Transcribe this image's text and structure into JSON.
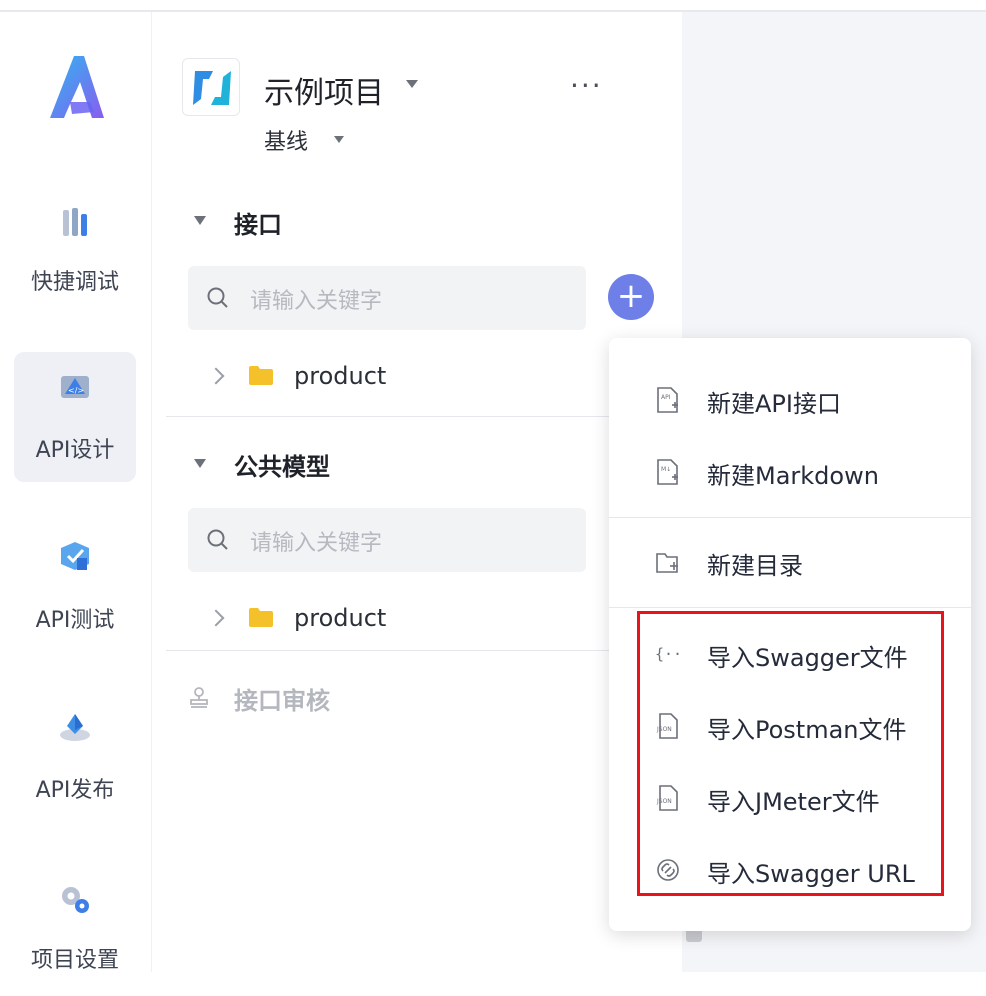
{
  "rail": {
    "items": [
      {
        "label": "快捷调试",
        "icon": "quick-debug-icon"
      },
      {
        "label": "API设计",
        "icon": "api-design-icon",
        "active": true
      },
      {
        "label": "API测试",
        "icon": "api-test-icon"
      },
      {
        "label": "API发布",
        "icon": "api-publish-icon"
      },
      {
        "label": "项目设置",
        "icon": "project-settings-icon"
      }
    ]
  },
  "project": {
    "name": "示例项目",
    "branch": "基线",
    "more": "···"
  },
  "sections": {
    "interfaces": {
      "title": "接口",
      "search_placeholder": "请输入关键字",
      "folder": "product"
    },
    "models": {
      "title": "公共模型",
      "search_placeholder": "请输入关键字",
      "folder": "product"
    },
    "audit": {
      "title": "接口审核"
    }
  },
  "add_button": "+",
  "menu": {
    "items": [
      {
        "label": "新建API接口",
        "icon": "new-api-file-icon"
      },
      {
        "label": "新建Markdown",
        "icon": "new-markdown-file-icon"
      },
      {
        "label": "新建目录",
        "icon": "new-folder-icon"
      },
      {
        "label": "导入Swagger文件",
        "icon": "braces-file-icon"
      },
      {
        "label": "导入Postman文件",
        "icon": "json-file-icon"
      },
      {
        "label": "导入JMeter文件",
        "icon": "json-file-icon"
      },
      {
        "label": "导入Swagger URL",
        "icon": "link-icon"
      }
    ]
  },
  "colors": {
    "accent": "#6e7fe8",
    "highlight": "#e8141a",
    "folder": "#f5c12b"
  }
}
